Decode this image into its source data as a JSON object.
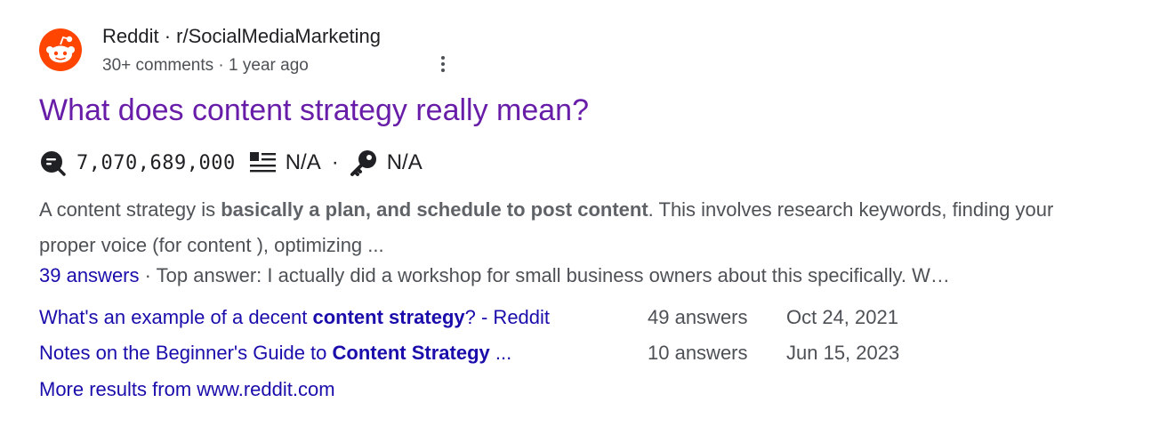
{
  "source": {
    "site": "Reddit",
    "separator": " · ",
    "path": "r/SocialMediaMarketing",
    "comments": "30+ comments",
    "dot": " · ",
    "age": "1 year ago",
    "logo_icon": "reddit-logo-icon",
    "menu_icon": "more-vert-icon"
  },
  "title": "What does content strategy really mean?",
  "metrics": {
    "search_volume": "7,070,689,000",
    "metric2": "N/A",
    "dot": "·",
    "metric3": "N/A",
    "icons": [
      "search-volume-icon",
      "list-icon",
      "key-icon"
    ]
  },
  "snippet": {
    "pre": "A content strategy is ",
    "bold": "basically a plan, and schedule to post content",
    "post": ". This involves research keywords, finding your proper voice (for content ), optimizing ..."
  },
  "answers": {
    "count_link": "39 answers",
    "sep": " · ",
    "text": "Top answer: I actually did a workshop for small business owners about this specifically. W…"
  },
  "related": [
    {
      "pre": "What's an example of a decent ",
      "bold": "content strategy",
      "post": "? - Reddit",
      "count": "49 answers",
      "date": "Oct 24, 2021"
    },
    {
      "pre": "Notes on the Beginner's Guide to ",
      "bold": "Content Strategy",
      "post": " ...",
      "count": "10 answers",
      "date": "Jun 15, 2023"
    }
  ],
  "more_results": "More results from www.reddit.com",
  "colors": {
    "visited_title": "#681da8",
    "link": "#1a0dab",
    "text": "#202124",
    "muted": "#4d5156",
    "reddit_orange": "#ff4500"
  }
}
